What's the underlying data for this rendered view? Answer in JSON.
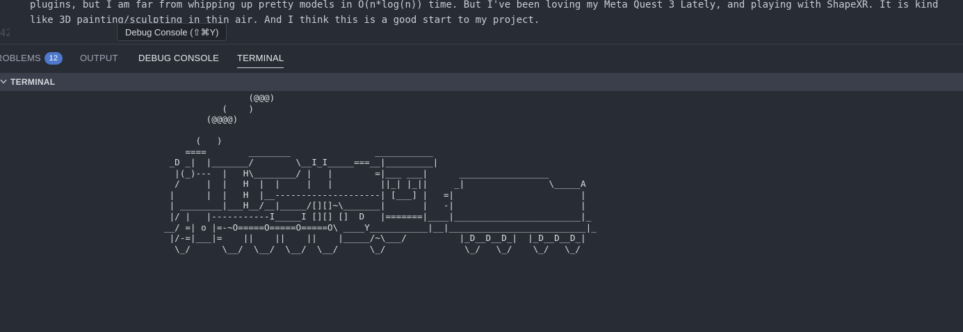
{
  "editor": {
    "line1": "plugins, but I am far from whipping up pretty models in O(n*log(n)) time. But I've been loving my Meta Quest 3 Lately, and playing with ShapeXR. It is kind",
    "line2": "like 3D painting/sculpting in thin air. And I think this is a good start to my project.",
    "line_number": "42"
  },
  "tooltip": {
    "text": "Debug Console (⇧⌘Y)"
  },
  "panel": {
    "tabs": {
      "problems": "PROBLEMS",
      "problems_count": "12",
      "output": "OUTPUT",
      "debug_console": "DEBUG CONSOLE",
      "terminal": "TERMINAL"
    },
    "section_title": "TERMINAL"
  },
  "terminal": {
    "output": "                (@@@)\n           (    )\n        (@@@@)\n\n      (   )\n    ====        ________                ___________\n _D _|  |_______/        \\__I_I_____===__|_________|\n  |(_)---  |   H\\________/ |   |        =|___ ___|      _________________\n  /     |  |   H  |  |     |   |         ||_| |_||     _|                \\_____A\n |      |  |   H  |__--------------------| [___] |   =|                        |\n | ________|___H__/__|_____/[][]~\\_______|       |   -|                        |\n |/ |   |-----------I_____I [][] []  D   |=======|____|________________________|_\n__/ =| o |=-~O=====O=====O=====O\\ ____Y___________|__|__________________________|_\n |/-=|___|=    ||    ||    ||    |_____/~\\___/          |_D__D__D_|  |_D__D__D_|\n  \\_/      \\__/  \\__/  \\__/  \\__/      \\_/               \\_/   \\_/    \\_/   \\_/"
  },
  "colors": {
    "background": "#282c34",
    "section_header": "#3a3f4b",
    "badge": "#4d78cc",
    "active_tab": "#e6e9ef",
    "inactive_tab": "#9da5b4"
  },
  "icons": {
    "section_toggle": "chevron-down-icon"
  }
}
